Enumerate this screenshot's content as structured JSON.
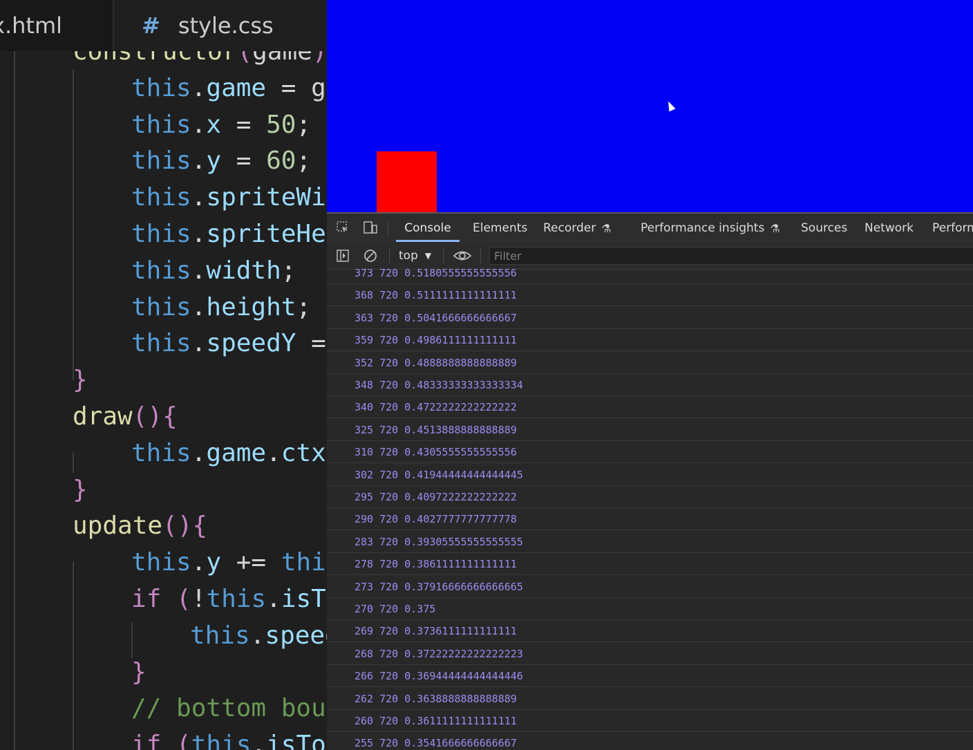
{
  "editor": {
    "tabs": [
      {
        "label": "x.html"
      },
      {
        "icon": "#",
        "label": "style.css"
      }
    ],
    "code_lines": [
      {
        "indent": 1,
        "tokens": [
          [
            "fn",
            "constructor"
          ],
          [
            "brace",
            "("
          ],
          [
            "plain",
            "game"
          ],
          [
            "brace",
            ")"
          ],
          [
            "brace",
            "{"
          ]
        ]
      },
      {
        "indent": 2,
        "tokens": [
          [
            "kw-this",
            "this"
          ],
          [
            "plain",
            "."
          ],
          [
            "prop",
            "game"
          ],
          [
            "plain",
            " = ga"
          ]
        ]
      },
      {
        "indent": 2,
        "tokens": [
          [
            "kw-this",
            "this"
          ],
          [
            "plain",
            "."
          ],
          [
            "prop",
            "x"
          ],
          [
            "plain",
            " = "
          ],
          [
            "num",
            "50"
          ],
          [
            "plain",
            ";"
          ]
        ]
      },
      {
        "indent": 2,
        "tokens": [
          [
            "kw-this",
            "this"
          ],
          [
            "plain",
            "."
          ],
          [
            "prop",
            "y"
          ],
          [
            "plain",
            " = "
          ],
          [
            "num",
            "60"
          ],
          [
            "plain",
            ";"
          ]
        ]
      },
      {
        "indent": 2,
        "tokens": [
          [
            "kw-this",
            "this"
          ],
          [
            "plain",
            "."
          ],
          [
            "prop",
            "spriteWid"
          ]
        ]
      },
      {
        "indent": 2,
        "tokens": [
          [
            "kw-this",
            "this"
          ],
          [
            "plain",
            "."
          ],
          [
            "prop",
            "spriteHei"
          ]
        ]
      },
      {
        "indent": 2,
        "tokens": [
          [
            "kw-this",
            "this"
          ],
          [
            "plain",
            "."
          ],
          [
            "prop",
            "width"
          ],
          [
            "plain",
            ";"
          ]
        ]
      },
      {
        "indent": 2,
        "tokens": [
          [
            "kw-this",
            "this"
          ],
          [
            "plain",
            "."
          ],
          [
            "prop",
            "height"
          ],
          [
            "plain",
            ";"
          ]
        ]
      },
      {
        "indent": 2,
        "tokens": [
          [
            "kw-this",
            "this"
          ],
          [
            "plain",
            "."
          ],
          [
            "prop",
            "speedY"
          ],
          [
            "plain",
            " ="
          ]
        ]
      },
      {
        "indent": 1,
        "tokens": [
          [
            "brace",
            "}"
          ]
        ]
      },
      {
        "indent": 1,
        "tokens": [
          [
            "fn",
            "draw"
          ],
          [
            "brace",
            "()"
          ],
          [
            "brace",
            "{"
          ]
        ]
      },
      {
        "indent": 2,
        "tokens": [
          [
            "kw-this",
            "this"
          ],
          [
            "plain",
            "."
          ],
          [
            "prop",
            "game"
          ],
          [
            "plain",
            "."
          ],
          [
            "prop",
            "ctx"
          ]
        ]
      },
      {
        "indent": 1,
        "tokens": [
          [
            "brace",
            "}"
          ]
        ]
      },
      {
        "indent": 1,
        "tokens": [
          [
            "fn",
            "update"
          ],
          [
            "brace",
            "()"
          ],
          [
            "brace",
            "{"
          ]
        ]
      },
      {
        "indent": 2,
        "tokens": [
          [
            "kw-this",
            "this"
          ],
          [
            "plain",
            "."
          ],
          [
            "prop",
            "y"
          ],
          [
            "plain",
            " += "
          ],
          [
            "kw-this",
            "this"
          ]
        ]
      },
      {
        "indent": 2,
        "tokens": [
          [
            "kw-ctrl",
            "if"
          ],
          [
            "plain",
            " "
          ],
          [
            "brace",
            "("
          ],
          [
            "plain",
            "!"
          ],
          [
            "kw-this",
            "this"
          ],
          [
            "plain",
            "."
          ],
          [
            "prop",
            "isTo"
          ]
        ]
      },
      {
        "indent": 3,
        "tokens": [
          [
            "kw-this",
            "this"
          ],
          [
            "plain",
            "."
          ],
          [
            "prop",
            "speed"
          ]
        ]
      },
      {
        "indent": 2,
        "tokens": [
          [
            "brace",
            "}"
          ]
        ]
      },
      {
        "indent": 2,
        "tokens": [
          [
            "cmt",
            "// bottom boun"
          ]
        ]
      },
      {
        "indent": 2,
        "tokens": [
          [
            "kw-ctrl",
            "if"
          ],
          [
            "plain",
            " "
          ],
          [
            "brace",
            "("
          ],
          [
            "kw-this",
            "this"
          ],
          [
            "plain",
            "."
          ],
          [
            "prop",
            "isTou"
          ]
        ]
      }
    ]
  },
  "canvas": {
    "background": "#0000f4",
    "player_color": "#ff0000"
  },
  "devtools": {
    "tabs": [
      {
        "label": "Console",
        "active": true
      },
      {
        "label": "Elements"
      },
      {
        "label": "Recorder",
        "experimental": true
      },
      {
        "label": "Performance insights",
        "experimental": true
      },
      {
        "label": "Sources"
      },
      {
        "label": "Network"
      },
      {
        "label": "Perform"
      }
    ],
    "context": "top",
    "filter_placeholder": "Filter",
    "log_color": "#9d8cf0",
    "console_lines": [
      "373 720 0.5180555555555556",
      "368 720 0.5111111111111111",
      "363 720 0.5041666666666667",
      "359 720 0.4986111111111111",
      "352 720 0.4888888888888889",
      "348 720 0.48333333333333334",
      "340 720 0.4722222222222222",
      "325 720 0.4513888888888889",
      "310 720 0.4305555555555556",
      "302 720 0.41944444444444445",
      "295 720 0.4097222222222222",
      "290 720 0.4027777777777778",
      "283 720 0.39305555555555555",
      "278 720 0.3861111111111111",
      "273 720 0.37916666666666665",
      "270 720 0.375",
      "269 720 0.3736111111111111",
      "268 720 0.37222222222222223",
      "266 720 0.36944444444444446",
      "262 720 0.3638888888888889",
      "260 720 0.3611111111111111",
      "255 720 0.3541666666666667"
    ]
  }
}
